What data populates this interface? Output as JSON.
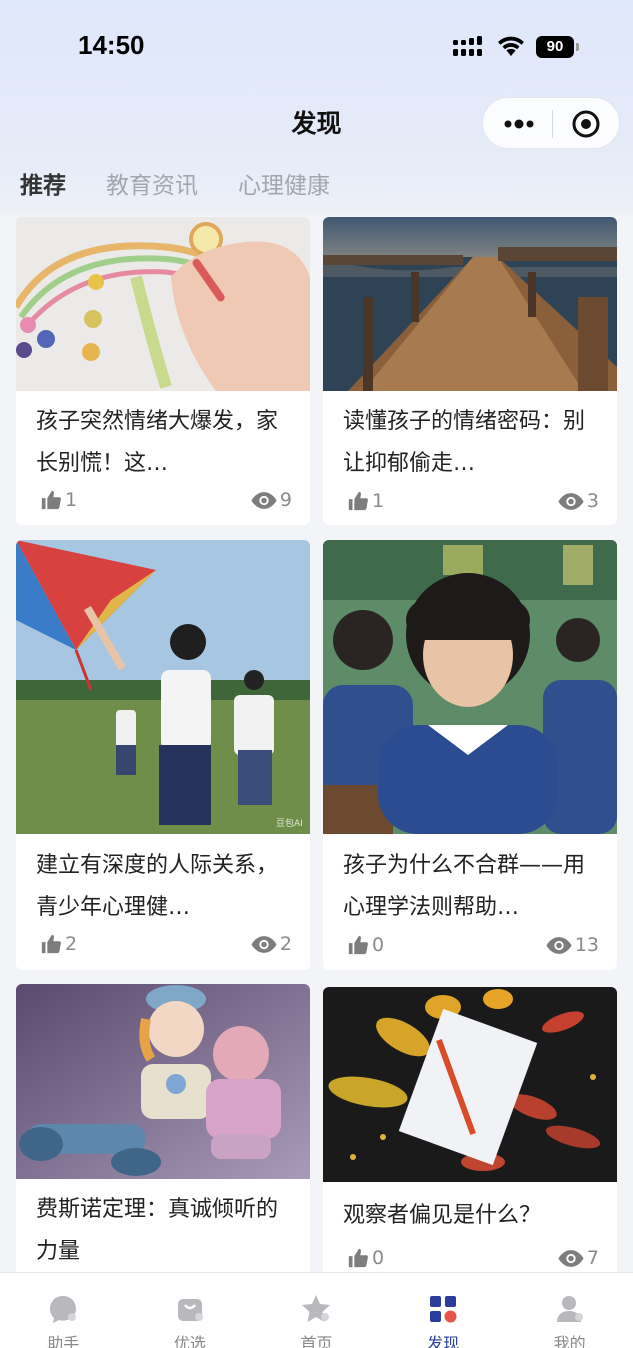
{
  "status_bar": {
    "time": "14:50",
    "battery": "90"
  },
  "header": {
    "title": "发现"
  },
  "tabs": [
    {
      "label": "推荐",
      "active": true
    },
    {
      "label": "教育资讯",
      "active": false
    },
    {
      "label": "心理健康",
      "active": false
    }
  ],
  "articles": [
    {
      "title": "孩子突然情绪大爆发，家长别慌！这…",
      "likes": "1",
      "views": "9",
      "image": "paper-quilling-photo"
    },
    {
      "title": "读懂孩子的情绪密码：别让抑郁偷走…",
      "likes": "1",
      "views": "3",
      "image": "pier-sunset-photo"
    },
    {
      "title": "建立有深度的人际关系，青少年心理健…",
      "likes": "2",
      "views": "2",
      "image": "kite-students-photo"
    },
    {
      "title": "孩子为什么不合群——用心理学法则帮助…",
      "likes": "0",
      "views": "13",
      "image": "classroom-child-photo"
    },
    {
      "title": "费斯诺定理：真诚倾听的力量",
      "likes": "",
      "views": "",
      "image": "dolls-photo"
    },
    {
      "title": "观察者偏见是什么？",
      "likes": "0",
      "views": "7",
      "image": "notepad-leaves-photo"
    }
  ],
  "watermark": "豆包AI",
  "bottom_nav": [
    {
      "label": "助手",
      "icon": "assistant-icon",
      "active": false
    },
    {
      "label": "优选",
      "icon": "bag-icon",
      "active": false
    },
    {
      "label": "首页",
      "icon": "home-star-icon",
      "active": false
    },
    {
      "label": "发现",
      "icon": "discover-grid-icon",
      "active": true
    },
    {
      "label": "我的",
      "icon": "profile-icon",
      "active": false
    }
  ],
  "colors": {
    "accent": "#2a3d9c",
    "inactive": "#888888",
    "dot": "#e5534b"
  }
}
